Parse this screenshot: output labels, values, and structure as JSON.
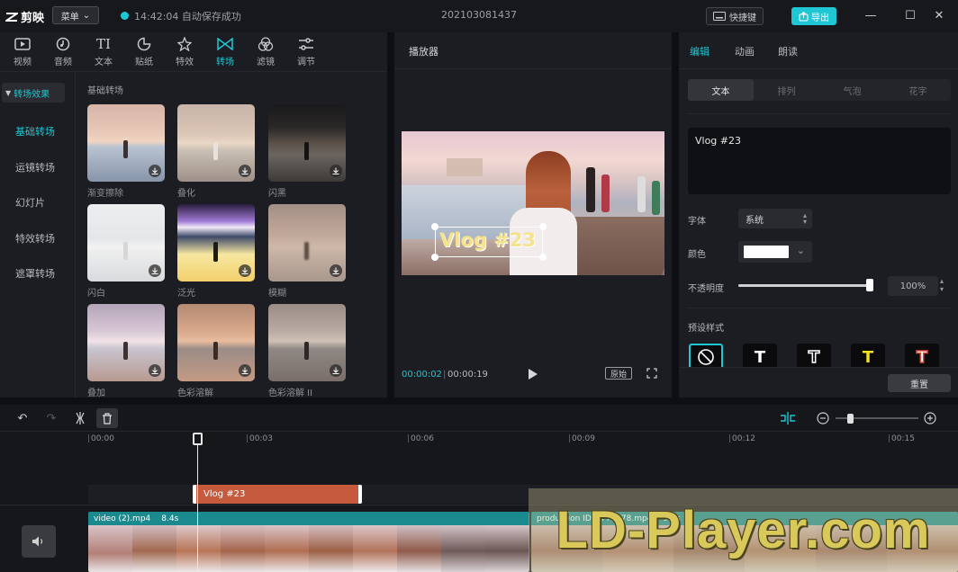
{
  "app": {
    "logo_text": "剪映",
    "menu_label": "菜单",
    "autosave_text": "14:42:04 自动保存成功",
    "project_title": "202103081437",
    "shortcut_label": "快捷键",
    "export_label": "导出"
  },
  "media_tabs": [
    {
      "label": "视频",
      "icon": "video-icon"
    },
    {
      "label": "音频",
      "icon": "audio-icon"
    },
    {
      "label": "文本",
      "icon": "text-icon"
    },
    {
      "label": "贴纸",
      "icon": "sticker-icon"
    },
    {
      "label": "特效",
      "icon": "effects-icon"
    },
    {
      "label": "转场",
      "icon": "transition-icon",
      "active": true
    },
    {
      "label": "滤镜",
      "icon": "filter-icon"
    },
    {
      "label": "调节",
      "icon": "adjust-icon"
    }
  ],
  "categories": {
    "header": "转场效果",
    "items": [
      "基础转场",
      "运镜转场",
      "幻灯片",
      "特效转场",
      "遮罩转场"
    ],
    "section_title": "基础转场"
  },
  "transitions": [
    {
      "label": "渐变擦除"
    },
    {
      "label": "叠化"
    },
    {
      "label": "闪黑"
    },
    {
      "label": "闪白"
    },
    {
      "label": "泛光"
    },
    {
      "label": "模糊"
    },
    {
      "label": "叠加"
    },
    {
      "label": "色彩溶解"
    },
    {
      "label": "色彩溶解 II"
    }
  ],
  "player": {
    "title": "播放器",
    "caption": "Vlog #23",
    "time_current": "00:00:02",
    "time_separator": "|",
    "time_total": "00:00:19",
    "ratio_label": "原始"
  },
  "inspector": {
    "tabs": [
      "编辑",
      "动画",
      "朗读"
    ],
    "subtabs": [
      "文本",
      "排列",
      "气泡",
      "花字"
    ],
    "text_value": "Vlog #23",
    "font_label": "字体",
    "font_value": "系统",
    "color_label": "颜色",
    "color_value": "#ffffff",
    "opacity_label": "不透明度",
    "opacity_value": "100%",
    "opacity_level": 1.0,
    "preset_label": "预设样式",
    "presets": [
      {
        "glyph": "",
        "color": "#ffffff"
      },
      {
        "glyph": "T",
        "color": "#ffffff"
      },
      {
        "glyph": "T",
        "color": "#0b0b0d"
      },
      {
        "glyph": "T",
        "color": "#f2e21a"
      },
      {
        "glyph": "T",
        "color": "#ffffff"
      }
    ],
    "reset_label": "重置"
  },
  "timeline": {
    "ruler": [
      "00:00",
      "00:03",
      "00:06",
      "00:09",
      "00:12",
      "00:15"
    ],
    "text_clip": "Vlog #23",
    "clips": [
      {
        "name": "video (2).mp4",
        "duration": "8.4s"
      },
      {
        "name": "production ID_3775278.mp4",
        "duration": "9.5s"
      }
    ],
    "zoom_level": 0.17
  },
  "watermark": "LD-Player.com"
}
